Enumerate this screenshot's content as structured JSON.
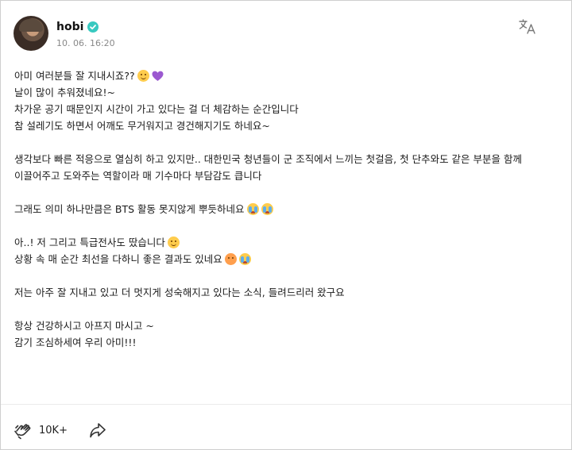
{
  "post": {
    "author": "hobi",
    "timestamp": "10. 06. 16:20",
    "verified": true,
    "accent_color": "#38c9c0",
    "paragraphs": [
      {
        "lines": [
          {
            "text": "아미 여러분들 잘 지내시죠??",
            "emoji": [
              "smiling-face",
              "purple-heart"
            ]
          },
          {
            "text": "날이 많이 추워졌네요!~",
            "emoji": []
          },
          {
            "text": "차가운 공기 때문인지 시간이 가고 있다는 걸 더 체감하는 순간입니다",
            "emoji": []
          },
          {
            "text": "참 설레기도 하면서 어깨도 무거워지고 경건해지기도 하네요~",
            "emoji": []
          }
        ]
      },
      {
        "lines": [
          {
            "text": "생각보다 빠른 적응으로 열심히 하고 있지만.. 대한민국 청년들이 군 조직에서 느끼는 첫걸음, 첫 단추와도 같은 부분을 함께",
            "emoji": []
          },
          {
            "text": "이끌어주고 도와주는 역할이라 매 기수마다 부담감도 큽니다",
            "emoji": []
          }
        ]
      },
      {
        "lines": [
          {
            "text": "그래도 의미 하나만큼은 BTS 활동 못지않게 뿌듯하네요",
            "emoji": [
              "crying-face",
              "crying-face"
            ]
          }
        ]
      },
      {
        "lines": [
          {
            "text": "아..! 저 그리고 특급전사도 땄습니다",
            "emoji": [
              "smiling-face"
            ]
          },
          {
            "text": "상황 속 매 순간 최선을 다하니 좋은 결과도 있네요",
            "emoji": [
              "blushing-face",
              "crying-face"
            ]
          }
        ]
      },
      {
        "lines": [
          {
            "text": "저는 아주 잘 지내고 있고 더 멋지게 성숙해지고 있다는 소식, 들려드리러 왔구요",
            "emoji": []
          }
        ]
      },
      {
        "lines": [
          {
            "text": "항상 건강하시고 아프지 마시고 ~",
            "emoji": []
          },
          {
            "text": "감기 조심하세여 우리 아미!!!",
            "emoji": []
          }
        ]
      }
    ]
  },
  "footer": {
    "like_count": "10K+",
    "like_icon": "like-hands-icon",
    "share_icon": "share-arrow-icon"
  },
  "toolbar": {
    "translate_icon": "translate-icon"
  }
}
